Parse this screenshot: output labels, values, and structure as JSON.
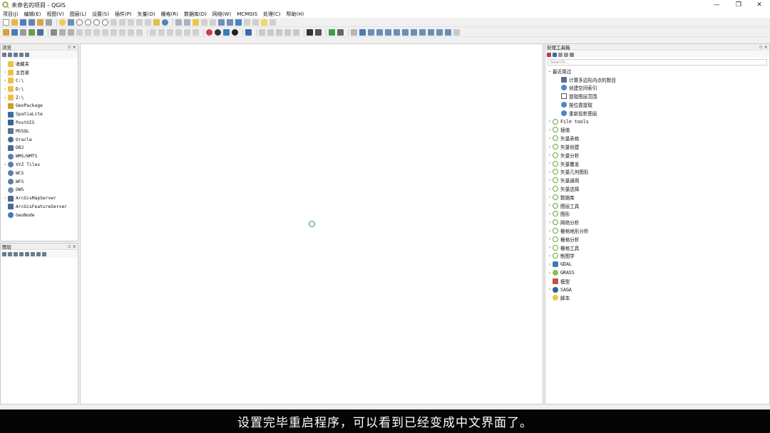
{
  "window": {
    "title": "未命名的项目 - QGIS",
    "controls": [
      "—",
      "❐",
      "✕"
    ]
  },
  "menu": [
    "项目(J)",
    "编辑(E)",
    "视图(V)",
    "图层(L)",
    "设置(S)",
    "插件(P)",
    "矢量(O)",
    "栅格(R)",
    "数据库(D)",
    "网络(W)",
    "MCMGIS",
    "处理(C)",
    "帮助(H)"
  ],
  "browser": {
    "title": "浏览",
    "items": [
      {
        "label": "收藏夹",
        "arrow": "",
        "icon": "star-icon",
        "color": "#e8c440"
      },
      {
        "label": "主目录",
        "arrow": "›",
        "icon": "folder-icon",
        "color": "#f0c040"
      },
      {
        "label": "C:\\",
        "arrow": "›",
        "icon": "folder-icon",
        "color": "#f0c040"
      },
      {
        "label": "D:\\",
        "arrow": "›",
        "icon": "folder-icon",
        "color": "#f0c040"
      },
      {
        "label": "Z:\\",
        "arrow": "›",
        "icon": "folder-icon",
        "color": "#f0c040"
      },
      {
        "label": "GeoPackage",
        "arrow": "",
        "icon": "geopackage-icon",
        "color": "#c9a227"
      },
      {
        "label": "SpatiaLite",
        "arrow": "",
        "icon": "spatialite-icon",
        "color": "#3b6ea8"
      },
      {
        "label": "PostGIS",
        "arrow": "",
        "icon": "postgis-icon",
        "color": "#336791"
      },
      {
        "label": "MSSQL",
        "arrow": "",
        "icon": "mssql-icon",
        "color": "#5a6f8c"
      },
      {
        "label": "Oracle",
        "arrow": "",
        "icon": "oracle-icon",
        "color": "#4a6a90"
      },
      {
        "label": "DB2",
        "arrow": "",
        "icon": "db2-icon",
        "color": "#4a6a90"
      },
      {
        "label": "WMS/WMTS",
        "arrow": "",
        "icon": "globe-icon",
        "color": "#5d7fa6"
      },
      {
        "label": "XYZ Tiles",
        "arrow": "›",
        "icon": "globe-icon",
        "color": "#5d7fa6"
      },
      {
        "label": "WCS",
        "arrow": "",
        "icon": "globe-icon",
        "color": "#5d7fa6"
      },
      {
        "label": "WFS",
        "arrow": "",
        "icon": "globe-icon",
        "color": "#5d7fa6"
      },
      {
        "label": "OWS",
        "arrow": "",
        "icon": "globe-icon",
        "color": "#7d8fa6"
      },
      {
        "label": "ArcGisMapServer",
        "arrow": "›",
        "icon": "arcgis-icon",
        "color": "#4a6a90"
      },
      {
        "label": "ArcGisFeatureServer",
        "arrow": "",
        "icon": "arcgis-icon",
        "color": "#4a6a90"
      },
      {
        "label": "GeoNode",
        "arrow": "",
        "icon": "geonode-icon",
        "color": "#3b7fbf"
      }
    ]
  },
  "layers": {
    "title": "图层"
  },
  "toolbox": {
    "title": "处理工具箱",
    "search_placeholder": "Search...",
    "recent_group": "最近用过",
    "recent_items": [
      "计算多边形内点的数目",
      "创建空间索引",
      "提取图层范围",
      "按位置提取",
      "重新投影图层"
    ],
    "groups": [
      {
        "label": "File tools",
        "icon": "qgis-icon"
      },
      {
        "label": "插值",
        "icon": "qgis-icon"
      },
      {
        "label": "矢量表格",
        "icon": "qgis-icon"
      },
      {
        "label": "矢量创建",
        "icon": "qgis-icon"
      },
      {
        "label": "矢量分析",
        "icon": "qgis-icon"
      },
      {
        "label": "矢量覆盖",
        "icon": "qgis-icon"
      },
      {
        "label": "矢量几何图形",
        "icon": "qgis-icon"
      },
      {
        "label": "矢量通用",
        "icon": "qgis-icon"
      },
      {
        "label": "矢量选择",
        "icon": "qgis-icon"
      },
      {
        "label": "数据库",
        "icon": "qgis-icon"
      },
      {
        "label": "图层工具",
        "icon": "qgis-icon"
      },
      {
        "label": "图形",
        "icon": "qgis-icon"
      },
      {
        "label": "网络分析",
        "icon": "qgis-icon"
      },
      {
        "label": "栅格地形分析",
        "icon": "qgis-icon"
      },
      {
        "label": "栅格分析",
        "icon": "qgis-icon"
      },
      {
        "label": "栅格工具",
        "icon": "qgis-icon"
      },
      {
        "label": "制图学",
        "icon": "qgis-icon"
      },
      {
        "label": "GDAL",
        "icon": "gdal-icon"
      },
      {
        "label": "GRASS",
        "icon": "grass-icon"
      },
      {
        "label": "模型",
        "icon": "model-icon",
        "noarrow": true
      },
      {
        "label": "SAGA",
        "icon": "saga-icon"
      },
      {
        "label": "脚本",
        "icon": "python-icon",
        "noarrow": true
      }
    ]
  },
  "subtitle": "设置完毕重启程序，可以看到已经变成中文界面了。"
}
